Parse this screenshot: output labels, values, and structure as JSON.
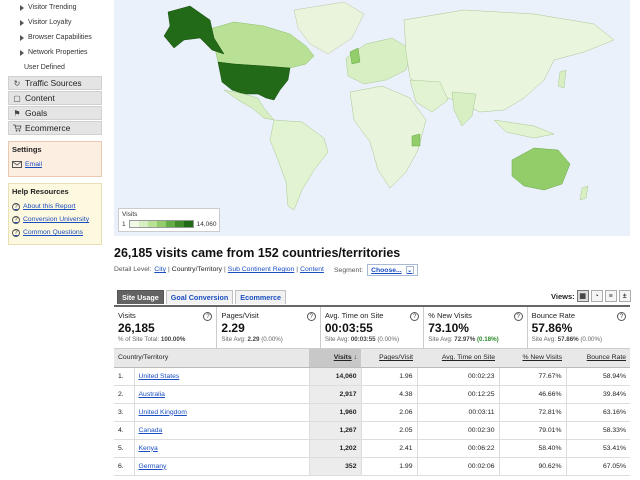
{
  "sidebar": {
    "sub_items": [
      {
        "label": "Visitor Trending",
        "arrow": true
      },
      {
        "label": "Visitor Loyalty",
        "arrow": true
      },
      {
        "label": "Browser Capabilities",
        "arrow": true
      },
      {
        "label": "Network Properties",
        "arrow": true
      },
      {
        "label": "User Defined",
        "arrow": false
      }
    ],
    "nav": [
      {
        "label": "Traffic Sources",
        "icon": "traffic-icon"
      },
      {
        "label": "Content",
        "icon": "content-icon"
      },
      {
        "label": "Goals",
        "icon": "flag-icon"
      },
      {
        "label": "Ecommerce",
        "icon": "cart-icon"
      }
    ],
    "settings": {
      "title": "Settings",
      "email": "Email"
    },
    "help": {
      "title": "Help Resources",
      "links": [
        "About this Report",
        "Conversion University",
        "Common Questions"
      ]
    }
  },
  "map": {
    "legend_title": "Visits",
    "legend_min": "1",
    "legend_max": "14,060",
    "colors": [
      "#f0f8e8",
      "#d8efc4",
      "#b9e196",
      "#92cd6a",
      "#63ad43",
      "#3f8b2c",
      "#226a17"
    ]
  },
  "headline": "26,185 visits came from 152 countries/territories",
  "detail": {
    "label": "Detail Level:",
    "levels": [
      "City",
      "Country/Territory",
      "Sub Continent Region",
      "Content"
    ],
    "current": "Country/Territory",
    "segment_label": "Segment:",
    "segment_value": "Choose..."
  },
  "tabs": [
    "Site Usage",
    "Goal Conversion",
    "Ecommerce"
  ],
  "views_label": "Views:",
  "summary": [
    {
      "label": "Visits",
      "value": "26,185",
      "sub_pre": "% of Site Total: ",
      "sub_val": "100.00%",
      "sub_post": ""
    },
    {
      "label": "Pages/Visit",
      "value": "2.29",
      "sub_pre": "Site Avg: ",
      "sub_val": "2.29",
      "sub_post": " (0.00%)"
    },
    {
      "label": "Avg. Time on Site",
      "value": "00:03:55",
      "sub_pre": "Site Avg: ",
      "sub_val": "00:03:55",
      "sub_post": " (0.00%)"
    },
    {
      "label": "% New Visits",
      "value": "73.10%",
      "sub_pre": "Site Avg: ",
      "sub_val": "72.97%",
      "sub_post": " (0.18%)"
    },
    {
      "label": "Bounce Rate",
      "value": "57.86%",
      "sub_pre": "Site Avg: ",
      "sub_val": "57.86%",
      "sub_post": " (0.00%)"
    }
  ],
  "table": {
    "headers": [
      "Country/Territory",
      "Visits",
      "Pages/Visit",
      "Avg. Time on Site",
      "% New Visits",
      "Bounce Rate"
    ],
    "rows": [
      {
        "n": "1.",
        "country": "United States",
        "visits": "14,060",
        "ppv": "1.96",
        "time": "00:02:23",
        "new": "77.67%",
        "bounce": "58.94%"
      },
      {
        "n": "2.",
        "country": "Australia",
        "visits": "2,917",
        "ppv": "4.38",
        "time": "00:12:25",
        "new": "46.66%",
        "bounce": "39.84%"
      },
      {
        "n": "3.",
        "country": "United Kingdom",
        "visits": "1,960",
        "ppv": "2.06",
        "time": "00:03:11",
        "new": "72.81%",
        "bounce": "63.16%"
      },
      {
        "n": "4.",
        "country": "Canada",
        "visits": "1,267",
        "ppv": "2.05",
        "time": "00:02:30",
        "new": "79.01%",
        "bounce": "58.33%"
      },
      {
        "n": "5.",
        "country": "Kenya",
        "visits": "1,202",
        "ppv": "2.41",
        "time": "00:06:22",
        "new": "58.40%",
        "bounce": "53.41%"
      },
      {
        "n": "6.",
        "country": "Germany",
        "visits": "352",
        "ppv": "1.99",
        "time": "00:02:06",
        "new": "90.62%",
        "bounce": "67.05%"
      }
    ]
  }
}
